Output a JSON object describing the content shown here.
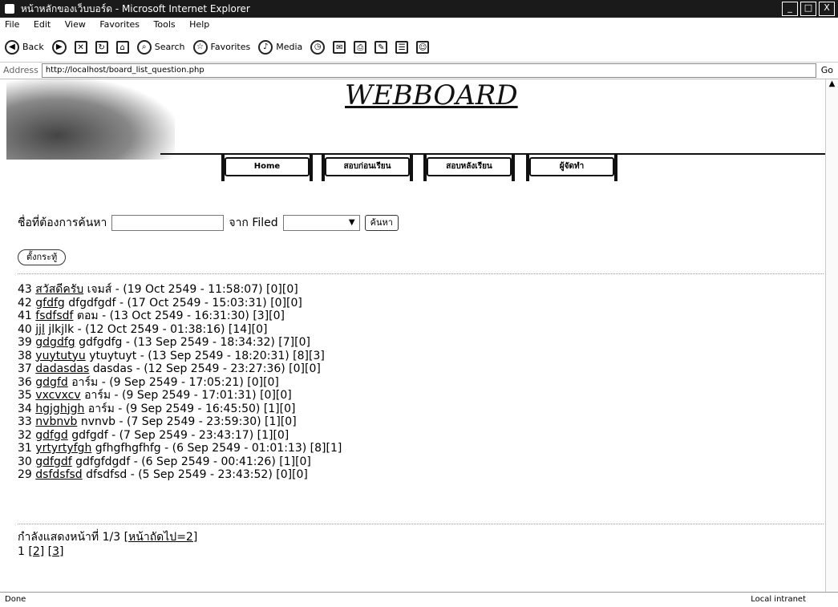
{
  "window": {
    "title": "หน้าหลักของเว็บบอร์ด - Microsoft Internet Explorer",
    "controls": [
      "_",
      "□",
      "X"
    ]
  },
  "menu": [
    "File",
    "Edit",
    "View",
    "Favorites",
    "Tools",
    "Help"
  ],
  "toolbar": {
    "back": "Back",
    "search": "Search",
    "favorites": "Favorites",
    "media": "Media"
  },
  "address": {
    "label": "Address",
    "url": "http://localhost/board_list_question.php",
    "go": "Go"
  },
  "header": {
    "title": "WEBBOARD",
    "nav": [
      "Home",
      "สอบก่อนเรียน",
      "สอบหลังเรียน",
      "ผู้จัดทำ"
    ]
  },
  "search": {
    "label": "ชื่อที่ต้องการค้นหา",
    "from_label": "จาก Filed",
    "button": "ค้นหา"
  },
  "new_post": "ตั้งกระทู้",
  "questions": [
    {
      "id": "43",
      "title": "สวัสดีครับ",
      "author": "เจมส์",
      "date": "(19 Oct 2549 - 11:58:07)",
      "counts": "[0][0]"
    },
    {
      "id": "42",
      "title": "gfdfg",
      "author": "dfgdfgdf",
      "date": "(17 Oct 2549 - 15:03:31)",
      "counts": "[0][0]"
    },
    {
      "id": "41",
      "title": "fsdfsdf",
      "author": "ตอม",
      "date": "(13 Oct 2549 - 16:31:30)",
      "counts": "[3][0]"
    },
    {
      "id": "40",
      "title": "jjl",
      "author": "jlkjlk",
      "date": "(12 Oct 2549 - 01:38:16)",
      "counts": "[14][0]"
    },
    {
      "id": "39",
      "title": "gdgdfg",
      "author": "gdfgdfg",
      "date": "(13 Sep 2549 - 18:34:32)",
      "counts": "[7][0]"
    },
    {
      "id": "38",
      "title": "yuytutyu",
      "author": "ytuytuyt",
      "date": "(13 Sep 2549 - 18:20:31)",
      "counts": "[8][3]"
    },
    {
      "id": "37",
      "title": "dadasdas",
      "author": "dasdas",
      "date": "(12 Sep 2549 - 23:27:36)",
      "counts": "[0][0]"
    },
    {
      "id": "36",
      "title": "gdgfd",
      "author": "อาร์ม",
      "date": "(9 Sep 2549 - 17:05:21)",
      "counts": "[0][0]"
    },
    {
      "id": "35",
      "title": "vxcvxcv",
      "author": "อาร์ม",
      "date": "(9 Sep 2549 - 17:01:31)",
      "counts": "[0][0]"
    },
    {
      "id": "34",
      "title": "hgjghjgh",
      "author": "อาร์ม",
      "date": "(9 Sep 2549 - 16:45:50)",
      "counts": "[1][0]"
    },
    {
      "id": "33",
      "title": "nvbnvb",
      "author": "nvnvb",
      "date": "(7 Sep 2549 - 23:59:30)",
      "counts": "[1][0]"
    },
    {
      "id": "32",
      "title": "gdfgd",
      "author": "gdfgdf",
      "date": "(7 Sep 2549 - 23:43:17)",
      "counts": "[1][0]"
    },
    {
      "id": "31",
      "title": "yrtyrtyfgh",
      "author": "gfhgfhgfhfg",
      "date": "(6 Sep 2549 - 01:01:13)",
      "counts": "[8][1]"
    },
    {
      "id": "30",
      "title": "gdfgdf",
      "author": "gdfgfdgdf",
      "date": "(6 Sep 2549 - 00:41:26)",
      "counts": "[1][0]"
    },
    {
      "id": "29",
      "title": "dsfdsfsd",
      "author": "dfsdfsd",
      "date": "(5 Sep 2549 - 23:43:52)",
      "counts": "[0][0]"
    }
  ],
  "pagination": {
    "status": "กำลังแสดงหน้าที่ 1/3",
    "next": "[หน้าถัดไป=2]",
    "current": "1",
    "pages": [
      "[2]",
      "[3]"
    ]
  },
  "status": {
    "left": "Done",
    "right": "Local intranet"
  }
}
